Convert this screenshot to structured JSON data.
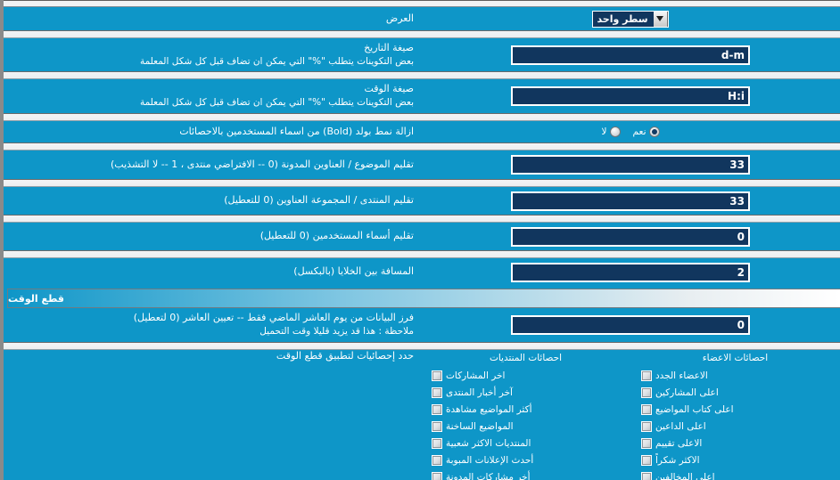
{
  "theme": {
    "background": "#0e96c8",
    "input_bg": "#11365e",
    "text": "#ffffff",
    "border_left": "#8a8a8a"
  },
  "display_row": {
    "label": "العرض",
    "select": {
      "value": "سطر واحد",
      "arrow_icon": "chevron-down-icon"
    }
  },
  "date_format_row": {
    "label": "صيغة التاريخ",
    "hint": "بعض التكوينات يتطلب \"%\" التي يمكن ان تضاف قبل كل شكل المعلمة",
    "value": "d-m"
  },
  "time_format_row": {
    "label": "صيغة الوقت",
    "hint": "بعض التكوينات يتطلب \"%\" التي يمكن ان تضاف قبل كل شكل المعلمة",
    "value": "H:i"
  },
  "bold_row": {
    "label": "ازالة نمط بولد (Bold) من اسماء المستخدمين بالاحصائات",
    "options": [
      {
        "label": "نعم",
        "checked": true
      },
      {
        "label": "لا",
        "checked": false
      }
    ]
  },
  "trim_topic_row": {
    "label": "تقليم الموضوع / العناوين المدونة (0 -- الافتراضي منتدى ، 1 -- لا التشذيب)",
    "value": "33"
  },
  "trim_forum_row": {
    "label": "تقليم المنتدى / المجموعة العناوين (0 للتعطيل)",
    "value": "33"
  },
  "trim_username_row": {
    "label": "تقليم أسماء المستخدمين (0 للتعطيل)",
    "value": "0"
  },
  "cell_spacing_row": {
    "label": "المسافة بين الخلايا (بالبكسل)",
    "value": "2"
  },
  "timecut_section": {
    "title": "قطع الوقت"
  },
  "timecut_row": {
    "label": "فرز البيانات من يوم العاشر الماضي فقط -- تعيين العاشر (0 لتعطيل)",
    "hint": "ملاحظة : هذا قد يزيد قليلا وقت التحميل",
    "value": "0"
  },
  "stats_select": {
    "label": "حدد إحصائيات لتطبيق قطع الوقت",
    "columns": [
      {
        "header": "احصائات الاعضاء",
        "items": [
          {
            "label": "الاعضاء الجدد",
            "checked": false
          },
          {
            "label": "اعلى المشاركين",
            "checked": false
          },
          {
            "label": "اعلى كتاب المواضيع",
            "checked": false
          },
          {
            "label": "اعلى الداعين",
            "checked": false
          },
          {
            "label": "الاعلى تقييم",
            "checked": false
          },
          {
            "label": "الاكثر شكراً",
            "checked": false
          },
          {
            "label": "اعلى المخالفين",
            "checked": false
          }
        ]
      },
      {
        "header": "احصائات المنتديات",
        "items": [
          {
            "label": "اخر المشاركات",
            "checked": false
          },
          {
            "label": "آخر أخبار المنتدى",
            "checked": false
          },
          {
            "label": "أكثر المواضيع مشاهدة",
            "checked": false
          },
          {
            "label": "المواضيع الساخنة",
            "checked": false
          },
          {
            "label": "المنتديات الاكثر شعبية",
            "checked": false
          },
          {
            "label": "أحدث الإعلانات المبوبة",
            "checked": false
          },
          {
            "label": "أخر مشاركات المدونة",
            "checked": false
          }
        ]
      }
    ]
  }
}
